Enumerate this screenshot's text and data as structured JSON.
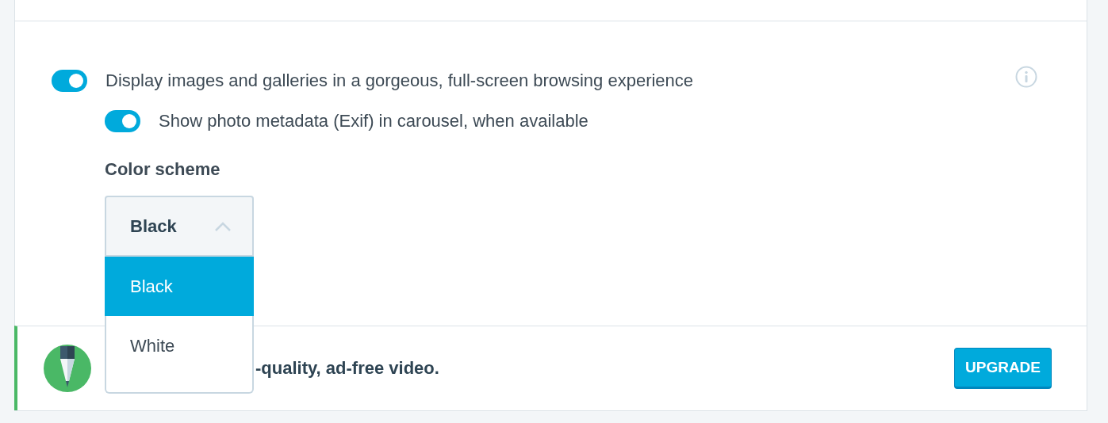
{
  "toggles": [
    {
      "label": "Display images and galleries in a gorgeous, full-screen browsing experience",
      "on": true,
      "children": [
        {
          "label": "Show photo metadata (Exif) in carousel, when available",
          "on": true
        }
      ]
    }
  ],
  "color_scheme": {
    "label": "Color scheme",
    "value": "Black",
    "expanded": true,
    "options": [
      {
        "label": "Black",
        "selected": true
      },
      {
        "label": "White",
        "selected": false
      }
    ]
  },
  "banner": {
    "text": "-quality, ad-free video.",
    "button": "UPGRADE"
  }
}
